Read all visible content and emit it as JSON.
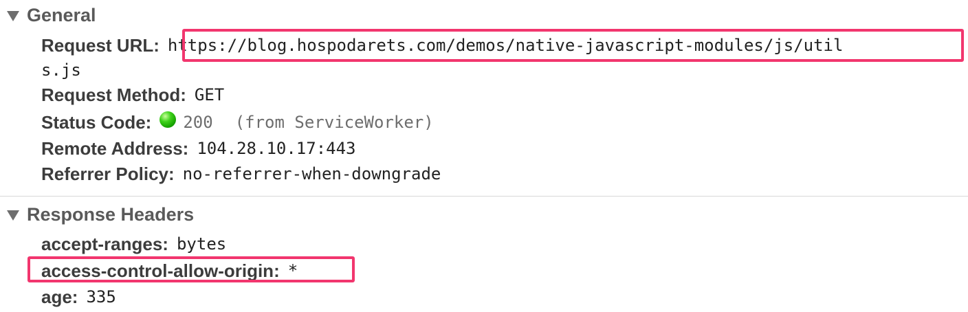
{
  "general": {
    "title": "General",
    "request_url_label": "Request URL:",
    "request_url_line1": "https://blog.hospodarets.com/demos/native-javascript-modules/js/util",
    "request_url_line2": "s.js",
    "request_method_label": "Request Method:",
    "request_method_value": "GET",
    "status_code_label": "Status Code:",
    "status_code_value": "200",
    "status_code_note": "(from ServiceWorker)",
    "status_icon": "green-status-dot-icon",
    "remote_address_label": "Remote Address:",
    "remote_address_value": "104.28.10.17:443",
    "referrer_policy_label": "Referrer Policy:",
    "referrer_policy_value": "no-referrer-when-downgrade"
  },
  "response_headers": {
    "title": "Response Headers",
    "items": [
      {
        "name": "accept-ranges:",
        "value": "bytes"
      },
      {
        "name": "access-control-allow-origin:",
        "value": "*"
      },
      {
        "name": "age:",
        "value": "335"
      }
    ]
  },
  "colors": {
    "highlight": "#f2366e",
    "status_ok": "#2fc40f"
  }
}
